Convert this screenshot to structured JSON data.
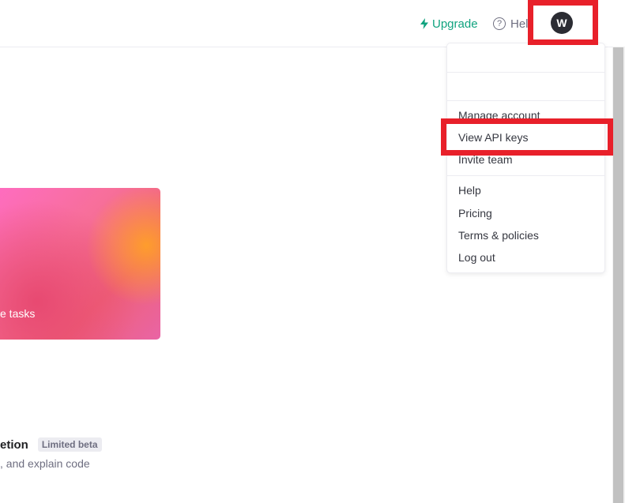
{
  "header": {
    "upgrade_label": "Upgrade",
    "help_label": "Help",
    "avatar_initial": "W"
  },
  "hero": {
    "caption": "e tasks"
  },
  "feature": {
    "title": "etion",
    "badge": "Limited beta",
    "description": ", and explain code"
  },
  "account_menu": {
    "items_group_1": [
      "Manage account",
      "View API keys",
      "Invite team"
    ],
    "items_group_2": [
      "Help",
      "Pricing",
      "Terms & policies",
      "Log out"
    ]
  },
  "colors": {
    "accent": "#10a37f",
    "highlight": "#e8202a",
    "avatar_bg": "#2b2c33"
  }
}
